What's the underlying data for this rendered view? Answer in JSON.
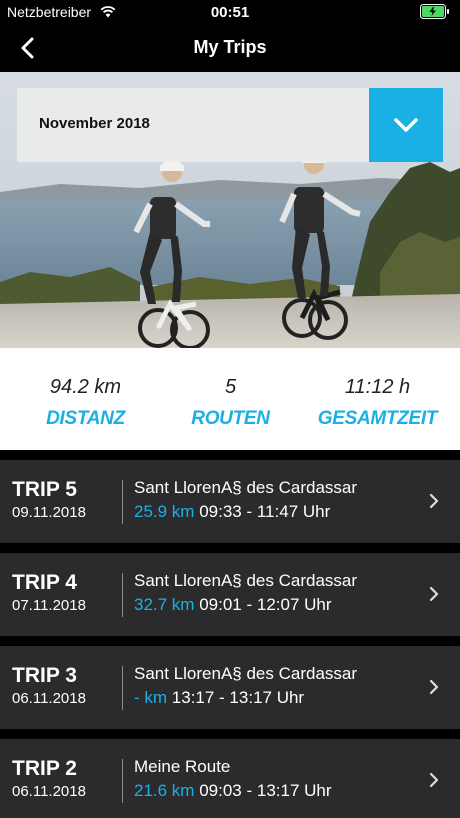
{
  "status_bar": {
    "carrier": "Netzbetreiber",
    "time": "00:51"
  },
  "nav": {
    "title": "My Trips"
  },
  "filter": {
    "month": "November 2018"
  },
  "stats": [
    {
      "value": "94.2 km",
      "label": "DISTANZ"
    },
    {
      "value": "5",
      "label": "ROUTEN"
    },
    {
      "value": "11:12 h",
      "label": "GESAMTZEIT"
    }
  ],
  "trips": [
    {
      "name": "TRIP 5",
      "date": "09.11.2018",
      "place": "Sant LlorenA§ des Cardassar",
      "distance": "25.9 km",
      "time": "09:33 - 11:47 Uhr"
    },
    {
      "name": "TRIP 4",
      "date": "07.11.2018",
      "place": "Sant LlorenA§ des Cardassar",
      "distance": "32.7 km",
      "time": "09:01 - 12:07 Uhr"
    },
    {
      "name": "TRIP 3",
      "date": "06.11.2018",
      "place": "Sant LlorenA§ des Cardassar",
      "distance": "- km",
      "time": "13:17 - 13:17 Uhr"
    },
    {
      "name": "TRIP 2",
      "date": "06.11.2018",
      "place": "Meine Route",
      "distance": "21.6 km",
      "time": "09:03 - 13:17 Uhr"
    }
  ],
  "colors": {
    "accent": "#1ab0e6",
    "row_bg": "#2b2b2d",
    "battery": "#4cd964"
  },
  "icons": {
    "back": "chevron-left-icon",
    "dropdown": "chevron-down-icon",
    "row": "chevron-right-icon",
    "wifi": "wifi-icon",
    "battery": "battery-charging-icon"
  }
}
